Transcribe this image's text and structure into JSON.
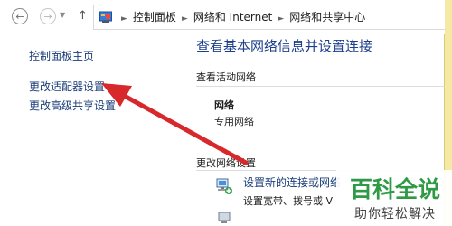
{
  "nav": {
    "back_icon": "back-arrow-icon",
    "forward_icon": "forward-arrow-icon",
    "up_icon": "up-arrow-icon",
    "breadcrumb": [
      "控制面板",
      "网络和 Internet",
      "网络和共享中心"
    ]
  },
  "left": {
    "links": [
      "控制面板主页",
      "更改适配器设置",
      "更改高级共享设置"
    ]
  },
  "main": {
    "title": "查看基本网络信息并设置连接",
    "active_section": "查看活动网络",
    "network_name": "网络",
    "network_type": "专用网络",
    "change_section": "更改网络设置",
    "new_conn_link": "设置新的连接或网络",
    "new_conn_desc": "设置宽带、拨号或 V"
  },
  "watermark": {
    "line1": "百科全说",
    "line2": "助你轻松解决"
  },
  "colors": {
    "link": "#1a3d78",
    "title": "#1e3f8c",
    "arrow": "#d7282c",
    "watermark_green": "#2f9a45"
  }
}
